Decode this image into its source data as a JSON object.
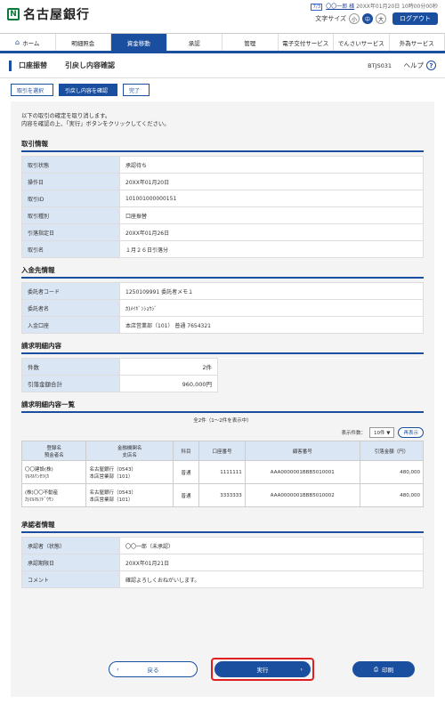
{
  "header": {
    "bank_name": "名古屋銀行",
    "user_badge": "7/3",
    "user_name": "〇〇一郎 様",
    "last_login": "20XX年01月20日 10時00分00秒",
    "font_size_label": "文字サイズ",
    "font_sizes": [
      "小",
      "中",
      "大"
    ],
    "logout": "ログアウト"
  },
  "nav": [
    "ホーム",
    "明細照会",
    "資金移動",
    "承認",
    "管理",
    "電子交付サービス",
    "でんさいサービス",
    "外為サービス"
  ],
  "title": {
    "section": "口座振替",
    "page": "引戻し内容確認",
    "code": "BTJS031",
    "help": "ヘルプ"
  },
  "steps": [
    "取引を選択",
    "引戻し内容を確認",
    "完了"
  ],
  "intro": [
    "以下の取引の確定を取り消します。",
    "内容を確認の上、「実行」ボタンをクリックしてください。"
  ],
  "txn_info": {
    "title": "取引情報",
    "rows": [
      {
        "k": "取引状態",
        "v": "承認待ち"
      },
      {
        "k": "操作日",
        "v": "20XX年01月20日"
      },
      {
        "k": "取引ID",
        "v": "101001000000151"
      },
      {
        "k": "取引種別",
        "v": "口座振替"
      },
      {
        "k": "引落指定日",
        "v": "20XX年01月26日"
      },
      {
        "k": "取引名",
        "v": "１月２６日引落分"
      }
    ]
  },
  "deposit_info": {
    "title": "入金先情報",
    "rows": [
      {
        "k": "委託者コード",
        "v": "1250109991 委託者メモ１"
      },
      {
        "k": "委託者名",
        "v": "ｶ)ﾒｲｷﾞﾝｼｮｳｼﾞ"
      },
      {
        "k": "入金口座",
        "v": "本店営業部（101） 普通 7654321"
      }
    ]
  },
  "billing_summary": {
    "title": "請求明細内容",
    "rows": [
      {
        "k": "件数",
        "v": "2件"
      },
      {
        "k": "引落金額合計",
        "v": "960,000円"
      }
    ]
  },
  "billing_list": {
    "title": "請求明細内容一覧",
    "count_note": "全2件（1～2件を表示中）",
    "display_label": "表示件数：",
    "display_value": "10件",
    "redisplay": "再表示",
    "headers": [
      [
        "登録名",
        "預金者名"
      ],
      [
        "金融機関名",
        "支店名"
      ],
      [
        "科目"
      ],
      [
        "口座番号"
      ],
      [
        "顧客番号"
      ],
      [
        "引落金額（円）"
      ]
    ],
    "rows": [
      {
        "name1": "〇〇建設(株)",
        "name2": "ﾏﾙﾏﾙｹﾝｾﾂ(ｶ",
        "bank1": "名古屋銀行（0543）",
        "bank2": "本店営業部（101）",
        "type": "普通",
        "acct": "1111111",
        "cust": "AAA0000001BBB5010001",
        "amount": "480,000"
      },
      {
        "name1": "(株)〇〇不動産",
        "name2": "ｶ)ﾏﾙﾏﾙﾌﾄﾞｳｻﾝ",
        "bank1": "名古屋銀行（0543）",
        "bank2": "本店営業部（101）",
        "type": "普通",
        "acct": "3333333",
        "cust": "AAA0000001BBB5010002",
        "amount": "480,000"
      }
    ]
  },
  "approver_info": {
    "title": "承認者情報",
    "rows": [
      {
        "k": "承認者（状態）",
        "v": "〇〇一郎（未承認）"
      },
      {
        "k": "承認期限日",
        "v": "20XX年01月21日"
      },
      {
        "k": "コメント",
        "v": "確認よろしくおねがいします。"
      }
    ]
  },
  "buttons": {
    "back": "戻る",
    "exec": "実行",
    "print": "印刷"
  }
}
